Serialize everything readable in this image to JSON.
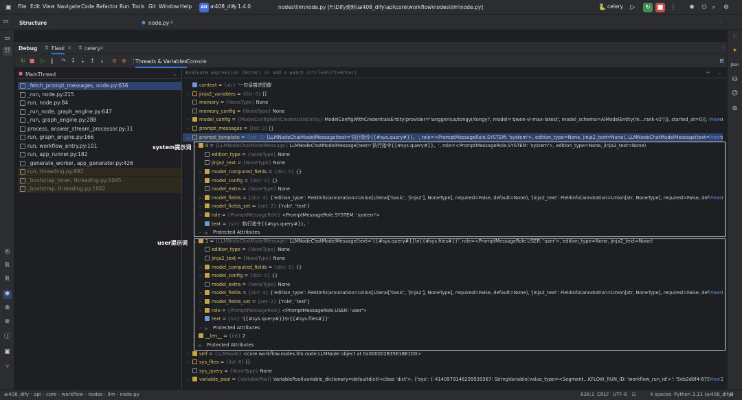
{
  "titlebar": {
    "project_badge": "AD",
    "project_name": "ai408_dify",
    "branch": "1.4.0",
    "menus": [
      "File",
      "Edit",
      "View",
      "Navigate",
      "Code",
      "Refactor",
      "Run",
      "Tools",
      "Git",
      "Window",
      "Help"
    ],
    "title": "nodes\\llm\\node.py [F:\\Dify资料\\ai408_dify\\api\\core\\workflow\\nodes\\llm\\node.py]",
    "run_config": "celery"
  },
  "structure_label": "Structure",
  "file_tab": "node.py",
  "debug": {
    "label": "Debug",
    "tabs": [
      "Flask",
      "celery"
    ],
    "view_tabs": [
      "Threads & Variables",
      "Console"
    ]
  },
  "frames": {
    "thread": "MainThread",
    "items": [
      {
        "text": "_fetch_prompt_messages, node.py:636",
        "dim": false,
        "sel": true
      },
      {
        "text": "_run, node.py:215",
        "dim": false,
        "sel": false
      },
      {
        "text": "run, node.py:84",
        "dim": false,
        "sel": false
      },
      {
        "text": "_run_node, graph_engine.py:647",
        "dim": false,
        "sel": false
      },
      {
        "text": "_run, graph_engine.py:288",
        "dim": false,
        "sel": false
      },
      {
        "text": "process, answer_stream_processor.py:31",
        "dim": false,
        "sel": false
      },
      {
        "text": "run, graph_engine.py:166",
        "dim": false,
        "sel": false
      },
      {
        "text": "run, workflow_entry.py:101",
        "dim": false,
        "sel": false
      },
      {
        "text": "run, app_runner.py:182",
        "dim": false,
        "sel": false
      },
      {
        "text": "_generate_worker, app_generator.py:426",
        "dim": false,
        "sel": false
      },
      {
        "text": "run, threading.py:982",
        "dim": true,
        "sel": false
      },
      {
        "text": "_bootstrap_inner, threading.py:1045",
        "dim": true,
        "sel": false
      },
      {
        "text": "_bootstrap, threading.py:1002",
        "dim": true,
        "sel": false
      }
    ]
  },
  "eval_placeholder": "Evaluate expression (Enter) or add a watch (Ctrl+Shift+Enter)",
  "annotations": {
    "system": "system提示词",
    "user": "user提示词"
  },
  "variables": [
    {
      "indent": 0,
      "arrow": "",
      "icon": "str",
      "name": "context",
      "type": "{str}",
      "value": "'一句话描述图像'",
      "view": ""
    },
    {
      "indent": 0,
      "arrow": "›",
      "icon": "list",
      "name": "jinja2_variables",
      "type": "{list: 0}",
      "value": "[]",
      "view": ""
    },
    {
      "indent": 0,
      "arrow": "",
      "icon": "none",
      "name": "memory",
      "type": "{NoneType}",
      "value": "None",
      "view": ""
    },
    {
      "indent": 0,
      "arrow": "",
      "icon": "none",
      "name": "memory_config",
      "type": "{NoneType}",
      "value": "None",
      "view": ""
    },
    {
      "indent": 0,
      "arrow": "›",
      "icon": "obj",
      "name": "model_config",
      "type": "{ModelConfigWithCredentialsEntity}",
      "value": "ModelConfigWithCredentialsEntity(provider='langgenius/tongyi/tongyi', model='qwen-vl-max-latest', model_schema=AIModelEntity(m...rank-v2')]), started_at=0)), credentials={'dashscop...",
      "view": "View"
    },
    {
      "indent": 0,
      "arrow": "›",
      "icon": "list",
      "name": "prompt_messages",
      "type": "{list: 0}",
      "value": "[]",
      "view": ""
    },
    {
      "indent": 0,
      "arrow": "⌄",
      "icon": "list",
      "name": "prompt_template",
      "type": "{list: 2}",
      "value": "[LLMNodeChatModelMessage(text='执行指令{{#sys.query#}}。', role=<PromptMessageRole.SYSTEM: 'system'>, edition_type=None, jinja2_text=None), LLMNodeChatModelMessage(text='{{#sys.query#}}\\n{{#sys.fil...",
      "view": "View",
      "hl": true
    },
    {
      "indent": 1,
      "arrow": "⌄",
      "icon": "obj",
      "name": "0",
      "type": "{LLMNodeChatModelMessage}",
      "value": "LLMNodeChatModelMessage(text='执行指令{{#sys.query#}}。', role=<PromptMessageRole.SYSTEM: 'system'>, edition_type=None, jinja2_text=None)",
      "view": ""
    },
    {
      "indent": 2,
      "arrow": "",
      "icon": "none",
      "name": "edition_type",
      "type": "{NoneType}",
      "value": "None",
      "view": ""
    },
    {
      "indent": 2,
      "arrow": "",
      "icon": "none",
      "name": "jinja2_text",
      "type": "{NoneType}",
      "value": "None",
      "view": ""
    },
    {
      "indent": 2,
      "arrow": "›",
      "icon": "obj",
      "name": "model_computed_fields",
      "type": "{dict: 0}",
      "value": "{}",
      "view": ""
    },
    {
      "indent": 2,
      "arrow": "›",
      "icon": "obj",
      "name": "model_config",
      "type": "{dict: 0}",
      "value": "{}",
      "view": ""
    },
    {
      "indent": 2,
      "arrow": "",
      "icon": "none",
      "name": "model_extra",
      "type": "{NoneType}",
      "value": "None",
      "view": ""
    },
    {
      "indent": 2,
      "arrow": "›",
      "icon": "obj",
      "name": "model_fields",
      "type": "{dict: 4}",
      "value": "{'edition_type': FieldInfo(annotation=Union[Literal['basic', 'jinja2'], NoneType], required=False, default=None), 'jinja2_text': FieldInfo(annotation=Union[str, NoneType], required=False, default=None), 'role': FieldIn...",
      "view": "View"
    },
    {
      "indent": 2,
      "arrow": "›",
      "icon": "obj",
      "name": "model_fields_set",
      "type": "{set: 2}",
      "value": "{'role', 'text'}",
      "view": ""
    },
    {
      "indent": 2,
      "arrow": "›",
      "icon": "obj",
      "name": "role",
      "type": "{PromptMessageRole}",
      "value": "<PromptMessageRole.SYSTEM: 'system'>",
      "view": ""
    },
    {
      "indent": 2,
      "arrow": "",
      "icon": "str",
      "name": "text",
      "type": "{str}",
      "value": "'执行指令{{#sys.query#}}。'",
      "view": ""
    },
    {
      "indent": 2,
      "arrow": "›",
      "icon": "prot",
      "name": "",
      "type": "",
      "value": "Protected Attributes",
      "view": ""
    },
    {
      "indent": 1,
      "arrow": "⌄",
      "icon": "obj",
      "name": "1",
      "type": "{LLMNodeChatModelMessage}",
      "value": "LLMNodeChatModelMessage(text='{{#sys.query#}}\\n{{#sys.files#}}', role=<PromptMessageRole.USER: 'user'>, edition_type=None, jinja2_text=None)",
      "view": ""
    },
    {
      "indent": 2,
      "arrow": "",
      "icon": "none",
      "name": "edition_type",
      "type": "{NoneType}",
      "value": "None",
      "view": ""
    },
    {
      "indent": 2,
      "arrow": "",
      "icon": "none",
      "name": "jinja2_text",
      "type": "{NoneType}",
      "value": "None",
      "view": ""
    },
    {
      "indent": 2,
      "arrow": "›",
      "icon": "obj",
      "name": "model_computed_fields",
      "type": "{dict: 0}",
      "value": "{}",
      "view": ""
    },
    {
      "indent": 2,
      "arrow": "›",
      "icon": "obj",
      "name": "model_config",
      "type": "{dict: 0}",
      "value": "{}",
      "view": ""
    },
    {
      "indent": 2,
      "arrow": "",
      "icon": "none",
      "name": "model_extra",
      "type": "{NoneType}",
      "value": "None",
      "view": ""
    },
    {
      "indent": 2,
      "arrow": "›",
      "icon": "obj",
      "name": "model_fields",
      "type": "{dict: 4}",
      "value": "{'edition_type': FieldInfo(annotation=Union[Literal['basic', 'jinja2'], NoneType], required=False, default=None), 'jinja2_text': FieldInfo(annotation=Union[str, NoneType], required=False, default=None), 'role': FieldIn...",
      "view": "View"
    },
    {
      "indent": 2,
      "arrow": "›",
      "icon": "obj",
      "name": "model_fields_set",
      "type": "{set: 2}",
      "value": "{'role', 'text'}",
      "view": ""
    },
    {
      "indent": 2,
      "arrow": "›",
      "icon": "obj",
      "name": "role",
      "type": "{PromptMessageRole}",
      "value": "<PromptMessageRole.USER: 'user'>",
      "view": ""
    },
    {
      "indent": 2,
      "arrow": "",
      "icon": "str",
      "name": "text",
      "type": "{str}",
      "value": "'{{#sys.query#}}\\n{{#sys.files#}}'",
      "view": ""
    },
    {
      "indent": 2,
      "arrow": "›",
      "icon": "prot",
      "name": "",
      "type": "",
      "value": "Protected Attributes",
      "view": ""
    },
    {
      "indent": 1,
      "arrow": "›",
      "icon": "obj",
      "name": "__len__",
      "type": "{int}",
      "value": "2",
      "view": ""
    },
    {
      "indent": 1,
      "arrow": "›",
      "icon": "prot",
      "name": "",
      "type": "",
      "value": "Protected Attributes",
      "view": ""
    },
    {
      "indent": 0,
      "arrow": "›",
      "icon": "obj",
      "name": "self",
      "type": "{LLMNode}",
      "value": "<core.workflow.nodes.llm.node.LLMNode object at 0x000002B35E1BE1D0>",
      "view": ""
    },
    {
      "indent": 0,
      "arrow": "›",
      "icon": "list",
      "name": "sys_files",
      "type": "{list: 0}",
      "value": "[]",
      "view": ""
    },
    {
      "indent": 0,
      "arrow": "",
      "icon": "none",
      "name": "sys_query",
      "type": "{NoneType}",
      "value": "None",
      "view": ""
    },
    {
      "indent": 0,
      "arrow": "›",
      "icon": "obj",
      "name": "variable_pool",
      "type": "{VariablePool}",
      "value": "VariablePool(variable_dictionary=defaultdict(<class 'dict'>, {'sys': {-4140979146299939367: StringVariable(value_type=<Segment...KFLOW_RUN_ID: 'workflow_run_id'>': '5eb2d8f4-679d-473e-bb1a-e65cb04d8f16...",
      "view": "View"
    }
  ],
  "statusbar": {
    "breadcrumb": [
      "ai408_dify",
      "api",
      "core",
      "workflow",
      "nodes",
      "llm",
      "node.py"
    ],
    "position": "636:1",
    "line_sep": "CRLF",
    "encoding": "UTF-8",
    "indent": "4 spaces",
    "interpreter": "Python 3.11 (ai408_dify)"
  }
}
